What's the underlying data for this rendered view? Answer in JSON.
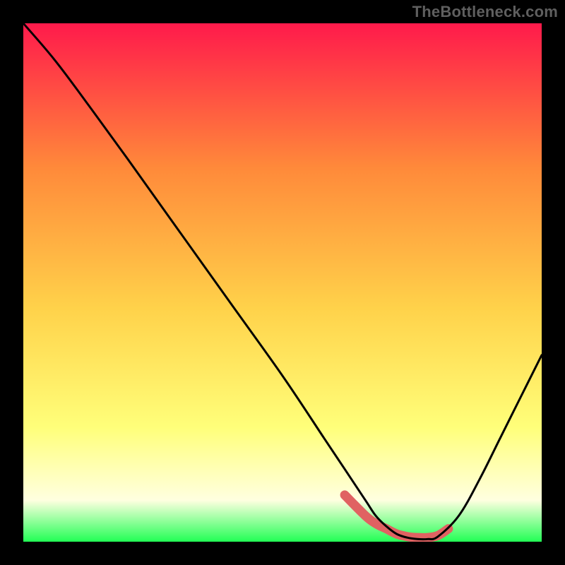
{
  "watermark": "TheBottleneck.com",
  "colors": {
    "gradient_top": "#ff1a4b",
    "gradient_mid_upper": "#ff8a3a",
    "gradient_mid": "#ffd24a",
    "gradient_mid_lower": "#ffff7a",
    "gradient_lower": "#ffffe0",
    "gradient_bottom": "#22ff55",
    "curve": "#000000",
    "band": "#e06262",
    "frame": "#000000"
  },
  "chart_data": {
    "type": "line",
    "title": "",
    "xlabel": "",
    "ylabel": "",
    "xlim": [
      0,
      100
    ],
    "ylim": [
      0,
      100
    ],
    "grid": false,
    "legend": false,
    "series": [
      {
        "name": "bottleneck-curve",
        "x": [
          0,
          6,
          12,
          20,
          30,
          40,
          50,
          58,
          62,
          66,
          68,
          70,
          72,
          74,
          76,
          78,
          80,
          84,
          88,
          92,
          96,
          100
        ],
        "y": [
          100,
          93,
          85,
          74,
          60,
          46,
          32,
          20,
          14,
          8,
          5,
          3,
          1.5,
          0.8,
          0.5,
          0.5,
          1,
          5,
          12,
          20,
          28,
          36
        ]
      }
    ],
    "optimal_band": {
      "name": "optimal-region",
      "x": [
        62,
        66,
        68,
        70,
        72,
        74,
        76,
        78,
        80,
        82
      ],
      "y": [
        9,
        5,
        3.5,
        2.5,
        1.5,
        1,
        0.8,
        0.8,
        1.2,
        2.5
      ]
    }
  }
}
